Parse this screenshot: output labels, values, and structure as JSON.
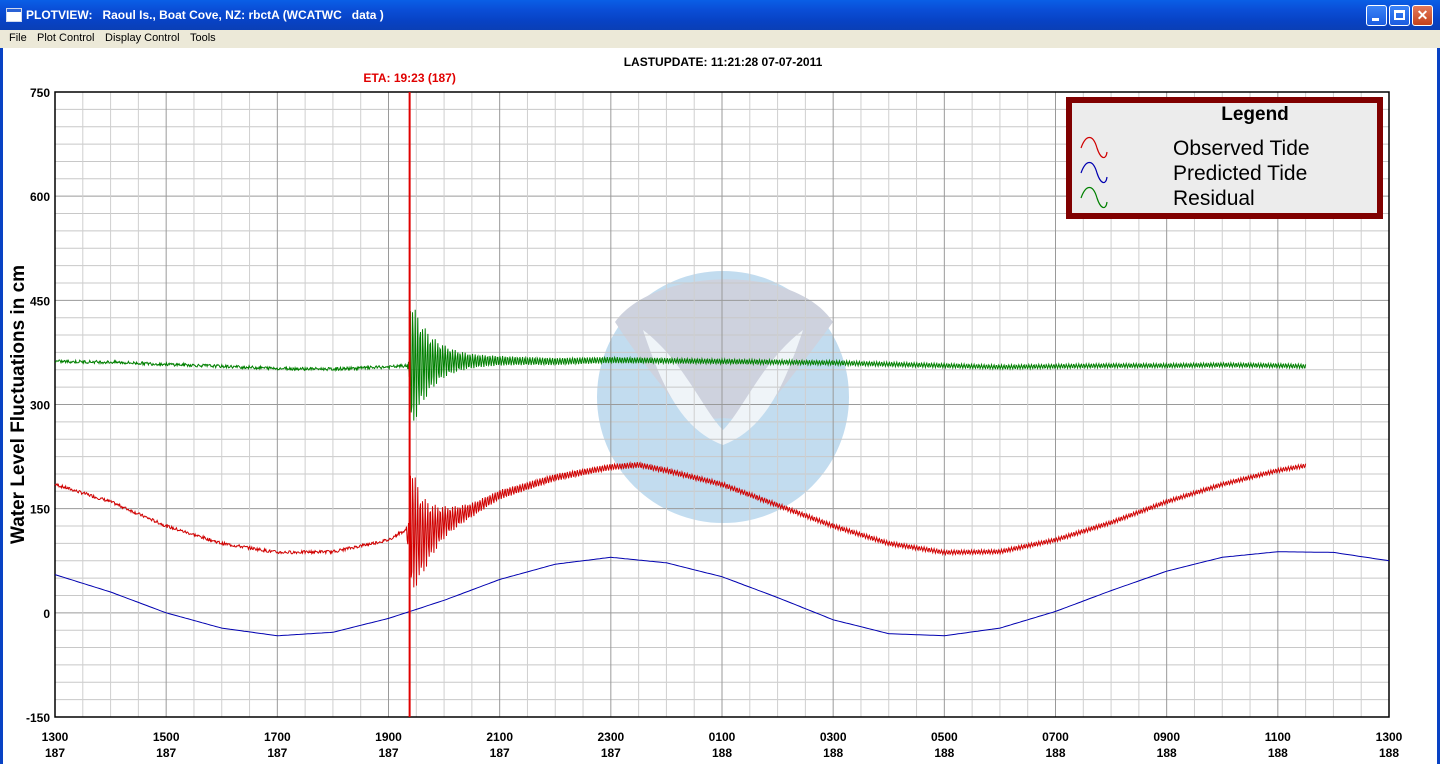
{
  "window": {
    "title": "PLOTVIEW:   Raoul Is., Boat Cove, NZ: rbctA (WCATWC   data )",
    "icon": "app-window-icon",
    "buttons": [
      "minimize-icon",
      "maximize-icon",
      "close-icon"
    ]
  },
  "menu": [
    "File",
    "Plot Control",
    "Display Control",
    "Tools"
  ],
  "header": {
    "lastupdate": "LASTUPDATE: 11:21:28  07-07-2011",
    "eta": "ETA: 19:23 (187)"
  },
  "colors": {
    "observed": "#d00000",
    "predicted": "#0000b0",
    "residual": "#008000",
    "eta_line": "#e00000",
    "legend_border": "#800000"
  },
  "chart_data": {
    "type": "line",
    "ylabel": "Water Level Fluctuations in cm",
    "ylim": [
      -150,
      750
    ],
    "yticks": [
      750,
      600,
      450,
      300,
      150,
      0,
      -150
    ],
    "xlim_hours": [
      13,
      37
    ],
    "xticks": [
      {
        "time": "1300",
        "day": "187"
      },
      {
        "time": "1500",
        "day": "187"
      },
      {
        "time": "1700",
        "day": "187"
      },
      {
        "time": "1900",
        "day": "187"
      },
      {
        "time": "2100",
        "day": "187"
      },
      {
        "time": "2300",
        "day": "187"
      },
      {
        "time": "0100",
        "day": "188"
      },
      {
        "time": "0300",
        "day": "188"
      },
      {
        "time": "0500",
        "day": "188"
      },
      {
        "time": "0700",
        "day": "188"
      },
      {
        "time": "0900",
        "day": "188"
      },
      {
        "time": "1100",
        "day": "188"
      },
      {
        "time": "1300",
        "day": "188"
      }
    ],
    "eta_hour": 19.38,
    "legend": {
      "title": "Legend",
      "placement": "top-right",
      "entries": [
        "Observed Tide",
        "Predicted Tide",
        "Residual"
      ]
    },
    "series": [
      {
        "name": "Observed Tide",
        "x": [
          13,
          14,
          15,
          16,
          17,
          18,
          19,
          19.2,
          19.38,
          19.6,
          20,
          20.5,
          21,
          22,
          23,
          23.5,
          24,
          25,
          26,
          27,
          28,
          29,
          30,
          31,
          32,
          33,
          34,
          35,
          35.5
        ],
        "values": [
          185,
          160,
          125,
          100,
          87,
          88,
          105,
          115,
          120,
          110,
          130,
          148,
          170,
          195,
          210,
          213,
          205,
          185,
          155,
          125,
          100,
          87,
          88,
          105,
          130,
          160,
          185,
          205,
          212
        ]
      },
      {
        "name": "Predicted Tide",
        "x": [
          13,
          14,
          15,
          16,
          17,
          18,
          19,
          20,
          21,
          22,
          23,
          24,
          25,
          26,
          27,
          28,
          29,
          30,
          31,
          32,
          33,
          34,
          35,
          36,
          37
        ],
        "values": [
          55,
          30,
          0,
          -22,
          -33,
          -28,
          -8,
          18,
          48,
          70,
          80,
          72,
          52,
          22,
          -10,
          -30,
          -33,
          -22,
          2,
          32,
          60,
          80,
          88,
          87,
          75
        ]
      },
      {
        "name": "Residual",
        "x": [
          13,
          14,
          15,
          16,
          17,
          18,
          19,
          19.38,
          20,
          21,
          22,
          23,
          24,
          25,
          26,
          27,
          28,
          29,
          30,
          31,
          32,
          33,
          34,
          35,
          35.5
        ],
        "values": [
          362,
          361,
          358,
          355,
          352,
          351,
          354,
          356,
          362,
          363,
          362,
          364,
          363,
          362,
          361,
          360,
          358,
          356,
          354,
          355,
          356,
          356,
          357,
          356,
          355
        ]
      }
    ]
  }
}
